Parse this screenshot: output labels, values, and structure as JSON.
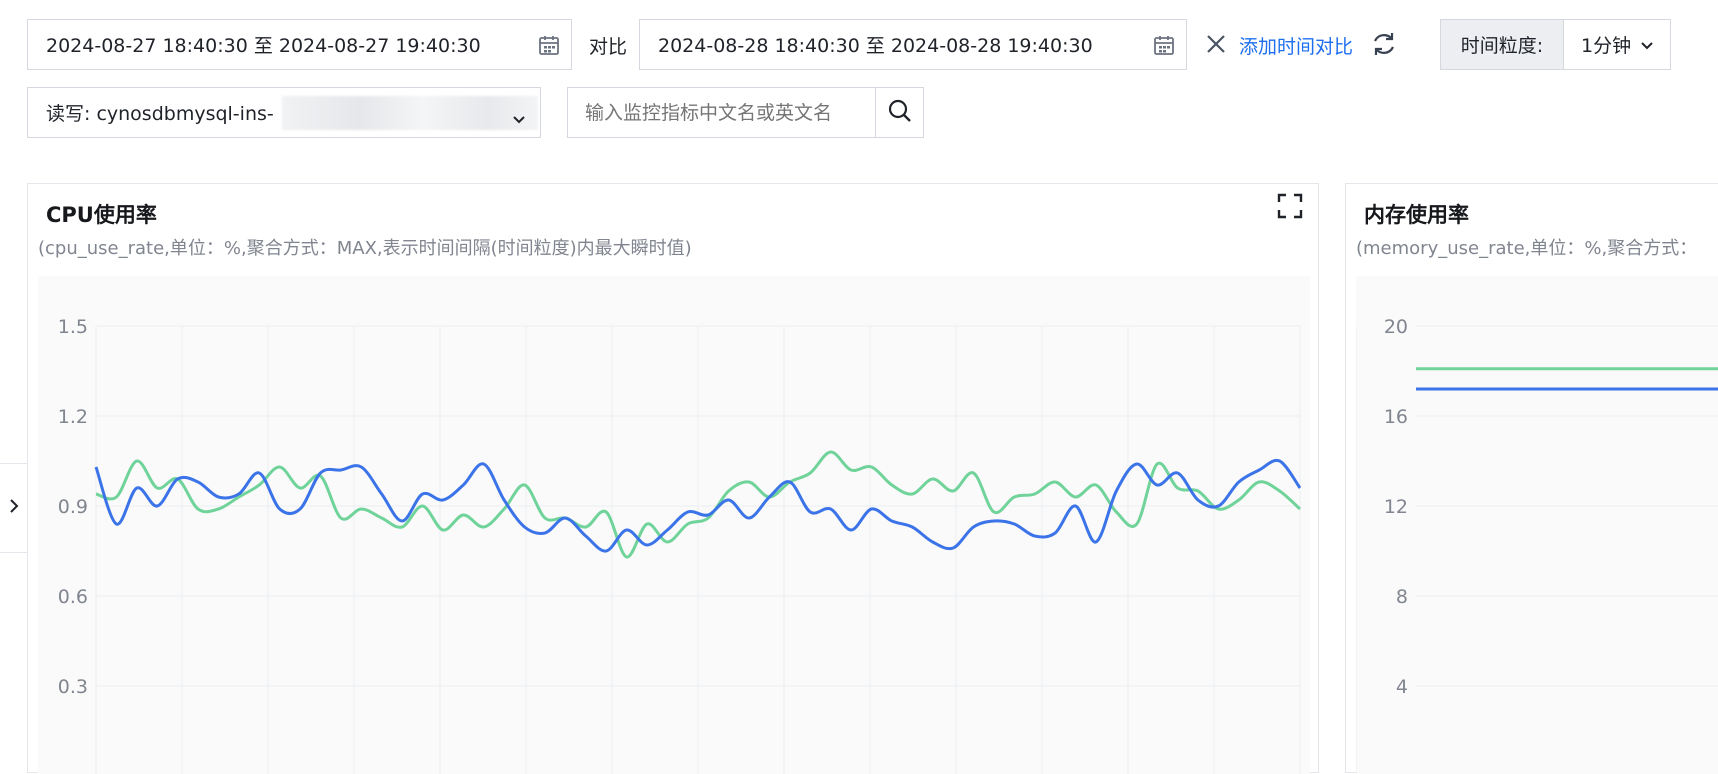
{
  "toolbar": {
    "range_primary": "2024-08-27 18:40:30 至 2024-08-27 19:40:30",
    "compare_label": "对比",
    "range_compare": "2024-08-28 18:40:30 至 2024-08-28 19:40:30",
    "add_compare_label": "添加时间对比",
    "granularity_label": "时间粒度:",
    "granularity_value": "1分钟",
    "instance_value": "读写: cynosdbmysql-ins-",
    "search_placeholder": "输入监控指标中文名或英文名"
  },
  "colors": {
    "series_primary": "#3b73e8",
    "series_compare": "#6fd39a",
    "link": "#1e6ff0"
  },
  "cpu_card": {
    "title": "CPU使用率",
    "subtitle": "(cpu_use_rate,单位：%,聚合方式：MAX,表示时间间隔(时间粒度)内最大瞬时值)"
  },
  "mem_card": {
    "title": "内存使用率",
    "subtitle": "(memory_use_rate,单位：%,聚合方式："
  },
  "chart_data": [
    {
      "type": "line",
      "title": "",
      "ylim": [
        0,
        1.5
      ],
      "yticks": [
        0.3,
        0.6,
        0.9,
        1.2,
        1.5
      ],
      "grid": true,
      "series": [
        {
          "values": [
            1.03,
            0.84,
            0.96,
            0.9,
            0.99,
            0.98,
            0.93,
            0.94,
            1.01,
            0.89,
            0.89,
            1.01,
            1.02,
            1.03,
            0.94,
            0.85,
            0.94,
            0.92,
            0.97,
            1.04,
            0.92,
            0.83,
            0.81,
            0.86,
            0.8,
            0.75,
            0.82,
            0.77,
            0.82,
            0.88,
            0.87,
            0.92,
            0.86,
            0.93,
            0.98,
            0.88,
            0.89,
            0.82,
            0.89,
            0.85,
            0.83,
            0.78,
            0.76,
            0.83,
            0.85,
            0.84,
            0.8,
            0.81,
            0.9,
            0.78,
            0.95,
            1.04,
            0.97,
            1.01,
            0.92,
            0.9,
            0.98,
            1.02,
            1.05,
            0.96
          ]
        },
        {
          "values": [
            0.94,
            0.93,
            1.05,
            0.96,
            0.99,
            0.89,
            0.89,
            0.93,
            0.97,
            1.03,
            0.96,
            1.0,
            0.86,
            0.89,
            0.86,
            0.83,
            0.9,
            0.82,
            0.87,
            0.83,
            0.89,
            0.97,
            0.86,
            0.86,
            0.83,
            0.88,
            0.73,
            0.84,
            0.78,
            0.84,
            0.86,
            0.95,
            0.98,
            0.93,
            0.98,
            1.01,
            1.08,
            1.02,
            1.03,
            0.97,
            0.94,
            0.99,
            0.95,
            1.01,
            0.88,
            0.93,
            0.94,
            0.98,
            0.93,
            0.97,
            0.88,
            0.84,
            1.04,
            0.96,
            0.95,
            0.89,
            0.92,
            0.98,
            0.95,
            0.89
          ]
        }
      ]
    },
    {
      "type": "line",
      "title": "",
      "ylim": [
        0,
        20
      ],
      "yticks": [
        4,
        8,
        12,
        16,
        20
      ],
      "grid": true,
      "series": [
        {
          "values": [
            17.2,
            17.2
          ]
        },
        {
          "values": [
            18.1,
            18.1
          ]
        }
      ]
    }
  ]
}
